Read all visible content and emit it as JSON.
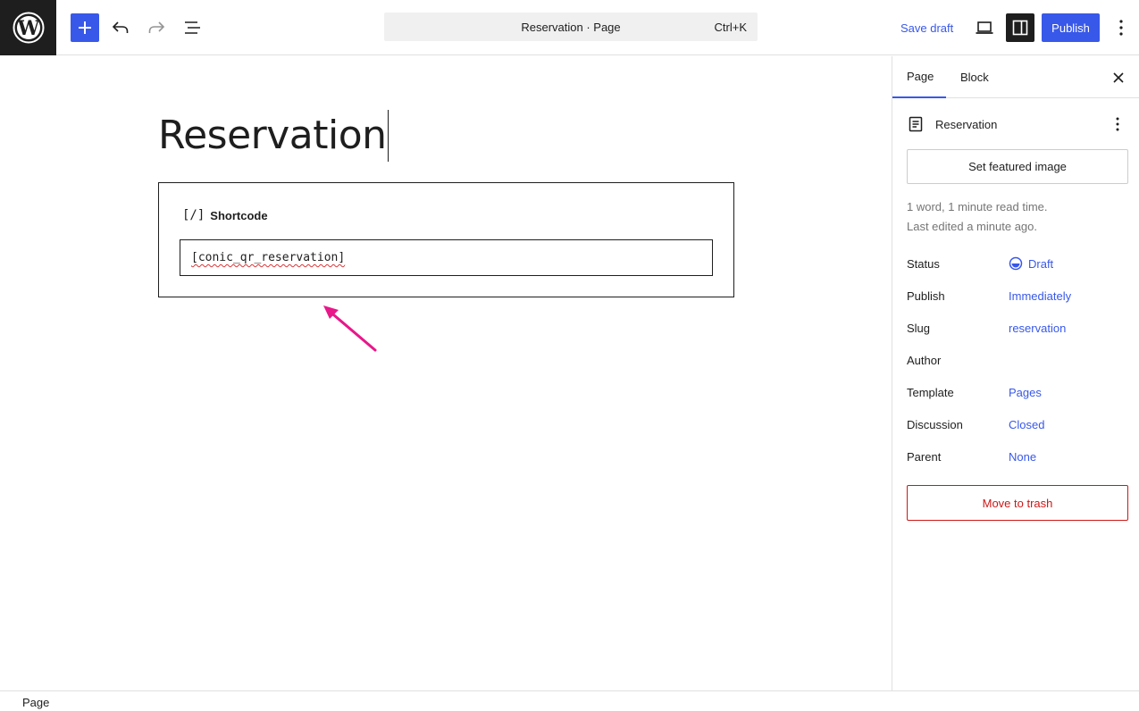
{
  "toolbar": {
    "logo": "wordpress-icon",
    "add_icon": "plus-icon",
    "undo_icon": "undo-icon",
    "redo_icon": "redo-icon",
    "list_view_icon": "list-view-icon",
    "command_title": "Reservation · Page",
    "command_shortcut": "Ctrl+K",
    "save_draft_label": "Save draft",
    "preview_icon": "desktop-icon",
    "settings_icon": "sidebar-icon",
    "publish_label": "Publish",
    "options_icon": "more-vertical-icon"
  },
  "editor": {
    "title": "Reservation",
    "shortcode_block": {
      "label": "Shortcode",
      "icon_glyph": "[/]",
      "value": "[conic_qr_reservation]"
    },
    "annotation_color": "#e8178a"
  },
  "sidebar": {
    "tabs": [
      {
        "label": "Page",
        "active": true
      },
      {
        "label": "Block",
        "active": false
      }
    ],
    "document_title": "Reservation",
    "featured_image_label": "Set featured image",
    "meta": {
      "line1": "1 word, 1 minute read time.",
      "line2": "Last edited a minute ago."
    },
    "props": [
      {
        "label": "Status",
        "value": "Draft"
      },
      {
        "label": "Publish",
        "value": "Immediately"
      },
      {
        "label": "Slug",
        "value": "reservation"
      },
      {
        "label": "Author",
        "value": ""
      },
      {
        "label": "Template",
        "value": "Pages"
      },
      {
        "label": "Discussion",
        "value": "Closed"
      },
      {
        "label": "Parent",
        "value": "None"
      }
    ],
    "trash_label": "Move to trash"
  },
  "footer": {
    "breadcrumb": "Page"
  },
  "colors": {
    "accent": "#3858e9",
    "danger": "#cc1818",
    "dark": "#1e1e1e"
  }
}
